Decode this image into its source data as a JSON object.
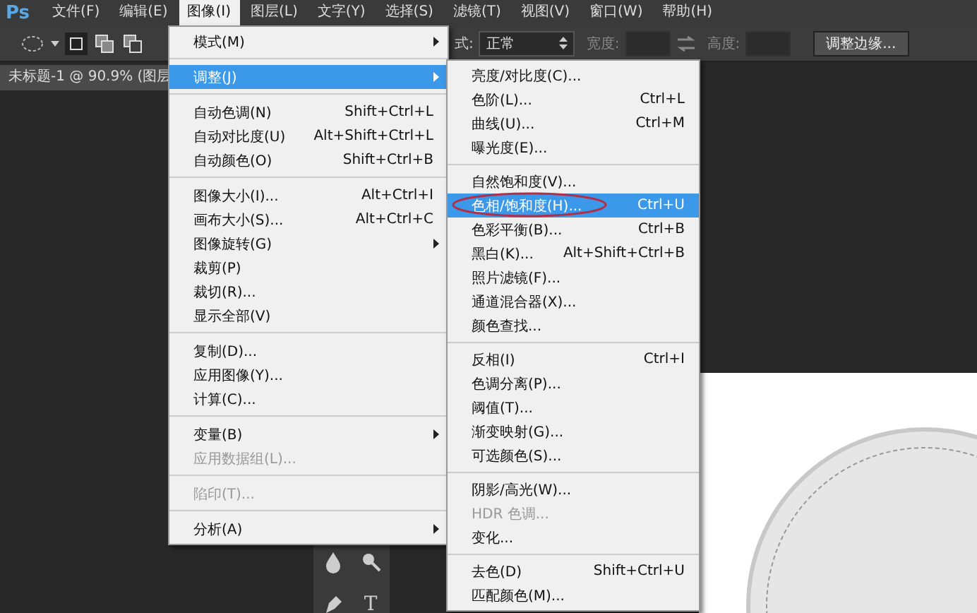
{
  "app_logo": "Ps",
  "menubar": [
    {
      "label": "文件(F)",
      "selected": false
    },
    {
      "label": "编辑(E)",
      "selected": false
    },
    {
      "label": "图像(I)",
      "selected": true
    },
    {
      "label": "图层(L)",
      "selected": false
    },
    {
      "label": "文字(Y)",
      "selected": false
    },
    {
      "label": "选择(S)",
      "selected": false
    },
    {
      "label": "滤镜(T)",
      "selected": false
    },
    {
      "label": "视图(V)",
      "selected": false
    },
    {
      "label": "窗口(W)",
      "selected": false
    },
    {
      "label": "帮助(H)",
      "selected": false
    }
  ],
  "options_bar": {
    "style_label": "式:",
    "style_value": "正常",
    "width_label": "宽度:",
    "height_label": "高度:",
    "refine_button": "调整边缘..."
  },
  "document_tab": "未标题-1 @ 90.9% (图层",
  "toolbox": {
    "type_tool_glyph": "T"
  },
  "image_menu": [
    {
      "kind": "item",
      "label": "模式(M)",
      "submenu": true,
      "disabled": false,
      "selected": false
    },
    {
      "kind": "separator"
    },
    {
      "kind": "item",
      "label": "调整(J)",
      "submenu": true,
      "disabled": false,
      "selected": true
    },
    {
      "kind": "separator"
    },
    {
      "kind": "item",
      "label": "自动色调(N)",
      "shortcut": "Shift+Ctrl+L",
      "submenu": false,
      "disabled": false,
      "selected": false
    },
    {
      "kind": "item",
      "label": "自动对比度(U)",
      "shortcut": "Alt+Shift+Ctrl+L",
      "submenu": false,
      "disabled": false,
      "selected": false
    },
    {
      "kind": "item",
      "label": "自动颜色(O)",
      "shortcut": "Shift+Ctrl+B",
      "submenu": false,
      "disabled": false,
      "selected": false
    },
    {
      "kind": "separator"
    },
    {
      "kind": "item",
      "label": "图像大小(I)...",
      "shortcut": "Alt+Ctrl+I",
      "submenu": false,
      "disabled": false,
      "selected": false
    },
    {
      "kind": "item",
      "label": "画布大小(S)...",
      "shortcut": "Alt+Ctrl+C",
      "submenu": false,
      "disabled": false,
      "selected": false
    },
    {
      "kind": "item",
      "label": "图像旋转(G)",
      "submenu": true,
      "disabled": false,
      "selected": false
    },
    {
      "kind": "item",
      "label": "裁剪(P)",
      "submenu": false,
      "disabled": false,
      "selected": false
    },
    {
      "kind": "item",
      "label": "裁切(R)...",
      "submenu": false,
      "disabled": false,
      "selected": false
    },
    {
      "kind": "item",
      "label": "显示全部(V)",
      "submenu": false,
      "disabled": false,
      "selected": false
    },
    {
      "kind": "separator"
    },
    {
      "kind": "item",
      "label": "复制(D)...",
      "submenu": false,
      "disabled": false,
      "selected": false
    },
    {
      "kind": "item",
      "label": "应用图像(Y)...",
      "submenu": false,
      "disabled": false,
      "selected": false
    },
    {
      "kind": "item",
      "label": "计算(C)...",
      "submenu": false,
      "disabled": false,
      "selected": false
    },
    {
      "kind": "separator"
    },
    {
      "kind": "item",
      "label": "变量(B)",
      "submenu": true,
      "disabled": false,
      "selected": false
    },
    {
      "kind": "item",
      "label": "应用数据组(L)...",
      "submenu": false,
      "disabled": true,
      "selected": false
    },
    {
      "kind": "separator"
    },
    {
      "kind": "item",
      "label": "陷印(T)...",
      "submenu": false,
      "disabled": true,
      "selected": false
    },
    {
      "kind": "separator"
    },
    {
      "kind": "item",
      "label": "分析(A)",
      "submenu": true,
      "disabled": false,
      "selected": false
    }
  ],
  "adjust_menu": [
    {
      "kind": "item",
      "label": "亮度/对比度(C)...",
      "disabled": false,
      "selected": false
    },
    {
      "kind": "item",
      "label": "色阶(L)...",
      "shortcut": "Ctrl+L",
      "disabled": false,
      "selected": false
    },
    {
      "kind": "item",
      "label": "曲线(U)...",
      "shortcut": "Ctrl+M",
      "disabled": false,
      "selected": false
    },
    {
      "kind": "item",
      "label": "曝光度(E)...",
      "disabled": false,
      "selected": false
    },
    {
      "kind": "separator"
    },
    {
      "kind": "item",
      "label": "自然饱和度(V)...",
      "disabled": false,
      "selected": false
    },
    {
      "kind": "item",
      "label": "色相/饱和度(H)...",
      "shortcut": "Ctrl+U",
      "disabled": false,
      "selected": true,
      "circled": true
    },
    {
      "kind": "item",
      "label": "色彩平衡(B)...",
      "shortcut": "Ctrl+B",
      "disabled": false,
      "selected": false
    },
    {
      "kind": "item",
      "label": "黑白(K)...",
      "shortcut": "Alt+Shift+Ctrl+B",
      "disabled": false,
      "selected": false
    },
    {
      "kind": "item",
      "label": "照片滤镜(F)...",
      "disabled": false,
      "selected": false
    },
    {
      "kind": "item",
      "label": "通道混合器(X)...",
      "disabled": false,
      "selected": false
    },
    {
      "kind": "item",
      "label": "颜色查找...",
      "disabled": false,
      "selected": false
    },
    {
      "kind": "separator"
    },
    {
      "kind": "item",
      "label": "反相(I)",
      "shortcut": "Ctrl+I",
      "disabled": false,
      "selected": false
    },
    {
      "kind": "item",
      "label": "色调分离(P)...",
      "disabled": false,
      "selected": false
    },
    {
      "kind": "item",
      "label": "阈值(T)...",
      "disabled": false,
      "selected": false
    },
    {
      "kind": "item",
      "label": "渐变映射(G)...",
      "disabled": false,
      "selected": false
    },
    {
      "kind": "item",
      "label": "可选颜色(S)...",
      "disabled": false,
      "selected": false
    },
    {
      "kind": "separator"
    },
    {
      "kind": "item",
      "label": "阴影/高光(W)...",
      "disabled": false,
      "selected": false
    },
    {
      "kind": "item",
      "label": "HDR 色调...",
      "disabled": true,
      "selected": false
    },
    {
      "kind": "item",
      "label": "变化...",
      "disabled": false,
      "selected": false
    },
    {
      "kind": "separator"
    },
    {
      "kind": "item",
      "label": "去色(D)",
      "shortcut": "Shift+Ctrl+U",
      "disabled": false,
      "selected": false
    },
    {
      "kind": "item",
      "label": "匹配颜色(M)...",
      "disabled": false,
      "selected": false
    }
  ]
}
